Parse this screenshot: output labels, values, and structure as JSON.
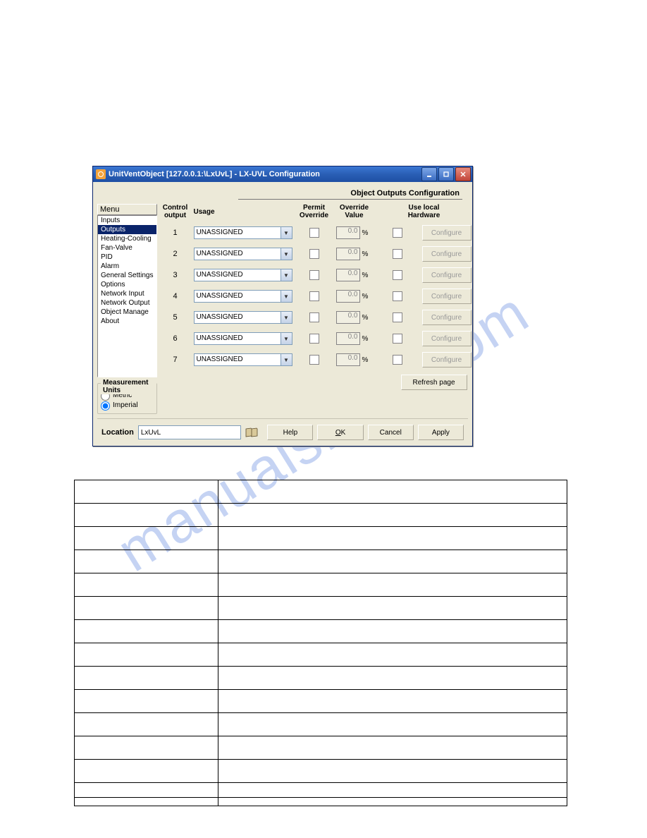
{
  "window": {
    "title": "UnitVentObject  [127.0.0.1:\\LxUvL] - LX-UVL Configuration"
  },
  "section_title": "Object Outputs Configuration",
  "menu": {
    "header": "Menu",
    "items": [
      {
        "label": "Inputs",
        "selected": false
      },
      {
        "label": "Outputs",
        "selected": true
      },
      {
        "label": "Heating-Cooling",
        "selected": false
      },
      {
        "label": "Fan-Valve",
        "selected": false
      },
      {
        "label": "PID",
        "selected": false
      },
      {
        "label": "Alarm",
        "selected": false
      },
      {
        "label": "General Settings",
        "selected": false
      },
      {
        "label": "Options",
        "selected": false
      },
      {
        "label": "Network Input",
        "selected": false
      },
      {
        "label": "Network Output",
        "selected": false
      },
      {
        "label": "Object Manage",
        "selected": false
      },
      {
        "label": "About",
        "selected": false
      }
    ]
  },
  "units": {
    "legend": "Measurement Units",
    "metric": "Metric",
    "imperial": "Imperial",
    "selected": "imperial"
  },
  "headers": {
    "control_output": "Control\noutput",
    "usage": "Usage",
    "permit_override": "Permit\nOverride",
    "override_value": "Override\nValue",
    "use_local_hardware": "Use local\nHardware"
  },
  "rows": [
    {
      "num": "1",
      "usage": "UNASSIGNED",
      "override_value": "0.0",
      "configure": "Configure"
    },
    {
      "num": "2",
      "usage": "UNASSIGNED",
      "override_value": "0.0",
      "configure": "Configure"
    },
    {
      "num": "3",
      "usage": "UNASSIGNED",
      "override_value": "0.0",
      "configure": "Configure"
    },
    {
      "num": "4",
      "usage": "UNASSIGNED",
      "override_value": "0.0",
      "configure": "Configure"
    },
    {
      "num": "5",
      "usage": "UNASSIGNED",
      "override_value": "0.0",
      "configure": "Configure"
    },
    {
      "num": "6",
      "usage": "UNASSIGNED",
      "override_value": "0.0",
      "configure": "Configure"
    },
    {
      "num": "7",
      "usage": "UNASSIGNED",
      "override_value": "0.0",
      "configure": "Configure"
    }
  ],
  "buttons": {
    "refresh": "Refresh page",
    "help": "Help",
    "ok": "OK",
    "cancel": "Cancel",
    "apply": "Apply"
  },
  "location": {
    "label": "Location",
    "value": "LxUvL"
  },
  "percent_sign": "%",
  "watermark": "manualshive.com"
}
